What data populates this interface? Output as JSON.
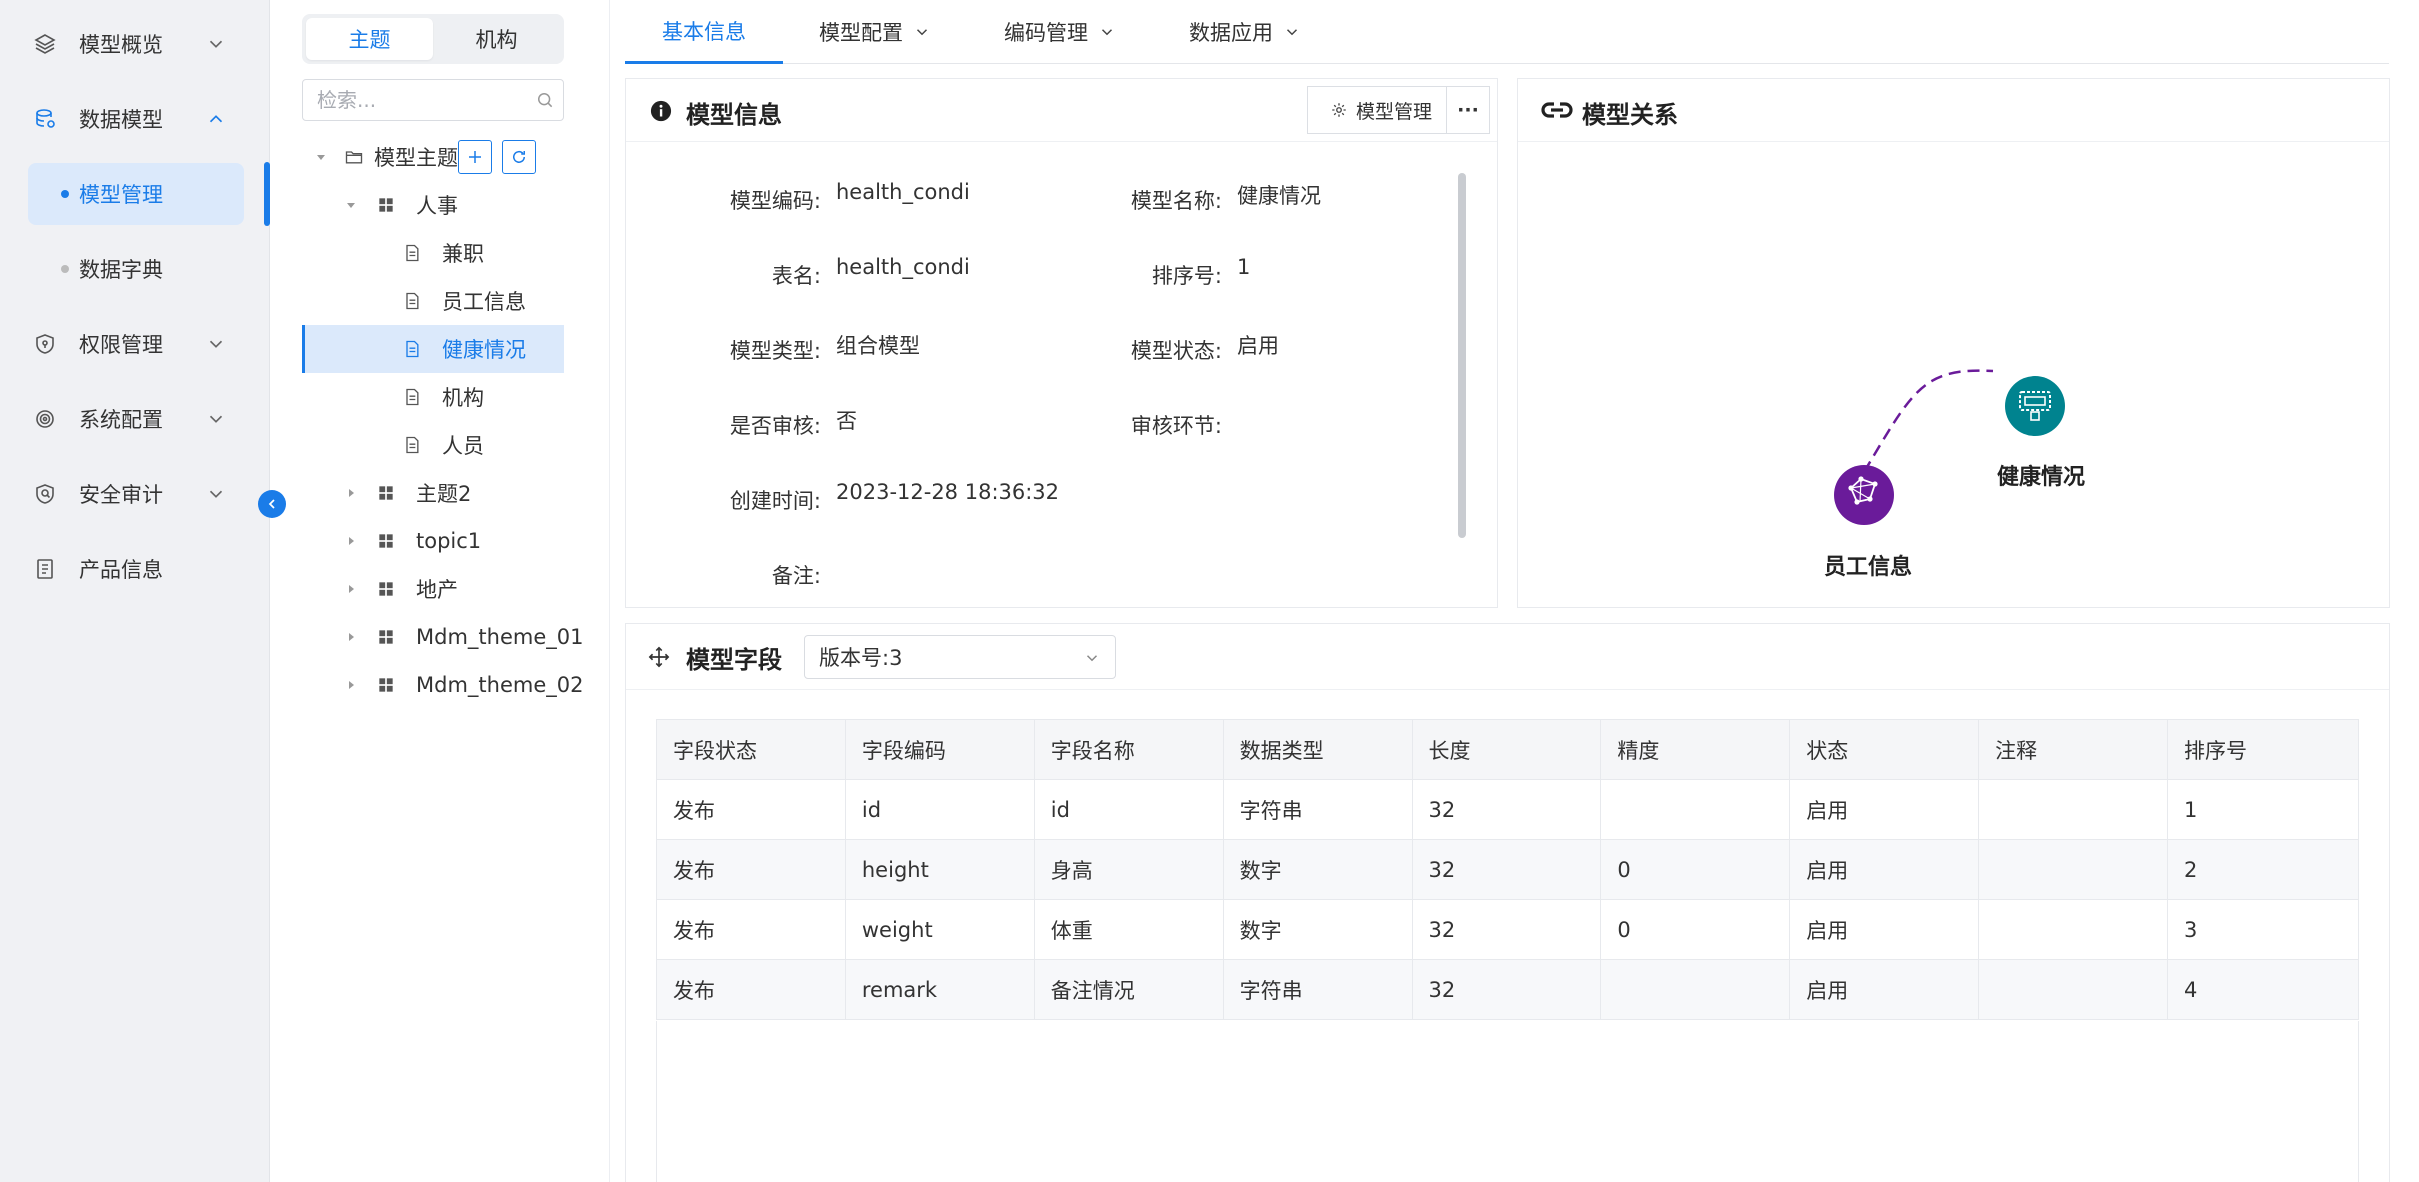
{
  "nav": {
    "items": [
      {
        "label": "模型概览",
        "icon": "layers-icon"
      },
      {
        "label": "数据模型",
        "icon": "database-icon"
      },
      {
        "label": "权限管理",
        "icon": "shield-icon"
      },
      {
        "label": "系统配置",
        "icon": "chip-icon"
      },
      {
        "label": "安全审计",
        "icon": "audit-shield-icon"
      },
      {
        "label": "产品信息",
        "icon": "document-list-icon"
      }
    ],
    "sub_items": [
      {
        "label": "模型管理",
        "active": true
      },
      {
        "label": "数据字典",
        "active": false
      }
    ]
  },
  "tree": {
    "tabs": [
      "主题",
      "机构"
    ],
    "search_placeholder": "检索...",
    "root_label": "模型主题",
    "nodes": [
      {
        "label": "人事"
      },
      {
        "label": "兼职"
      },
      {
        "label": "员工信息"
      },
      {
        "label": "健康情况"
      },
      {
        "label": "机构"
      },
      {
        "label": "人员"
      },
      {
        "label": "主题2"
      },
      {
        "label": "topic1"
      },
      {
        "label": "地产"
      },
      {
        "label": "Mdm_theme_01"
      },
      {
        "label": "Mdm_theme_02"
      }
    ]
  },
  "tabs": [
    "基本信息",
    "模型配置",
    "编码管理",
    "数据应用"
  ],
  "info": {
    "title": "模型信息",
    "manage_button": "模型管理",
    "more": "···",
    "fields": {
      "code_label": "模型编码:",
      "code_value": "health_condi",
      "name_label": "模型名称:",
      "name_value": "健康情况",
      "table_label": "表名:",
      "table_value": "health_condi",
      "order_label": "排序号:",
      "order_value": "1",
      "type_label": "模型类型:",
      "type_value": "组合模型",
      "status_label": "模型状态:",
      "status_value": "启用",
      "audit_label": "是否审核:",
      "audit_value": "否",
      "audit_step_label": "审核环节:",
      "audit_step_value": "",
      "created_label": "创建时间:",
      "created_value": "2023-12-28 18:36:32",
      "remark_label": "备注:"
    }
  },
  "relation": {
    "title": "模型关系",
    "nodes": [
      "健康情况",
      "员工信息"
    ]
  },
  "fields_panel": {
    "title": "模型字段",
    "version": "版本号:3",
    "columns": [
      "字段状态",
      "字段编码",
      "字段名称",
      "数据类型",
      "长度",
      "精度",
      "状态",
      "注释",
      "排序号"
    ],
    "rows": [
      [
        "发布",
        "id",
        "id",
        "字符串",
        "32",
        "",
        "启用",
        "",
        "1"
      ],
      [
        "发布",
        "height",
        "身高",
        "数字",
        "32",
        "0",
        "启用",
        "",
        "2"
      ],
      [
        "发布",
        "weight",
        "体重",
        "数字",
        "32",
        "0",
        "启用",
        "",
        "3"
      ],
      [
        "发布",
        "remark",
        "备注情况",
        "字符串",
        "32",
        "",
        "启用",
        "",
        "4"
      ]
    ]
  },
  "colors": {
    "accent": "#1a7ce8",
    "purple": "#6a1b9a",
    "teal": "#00838f"
  }
}
